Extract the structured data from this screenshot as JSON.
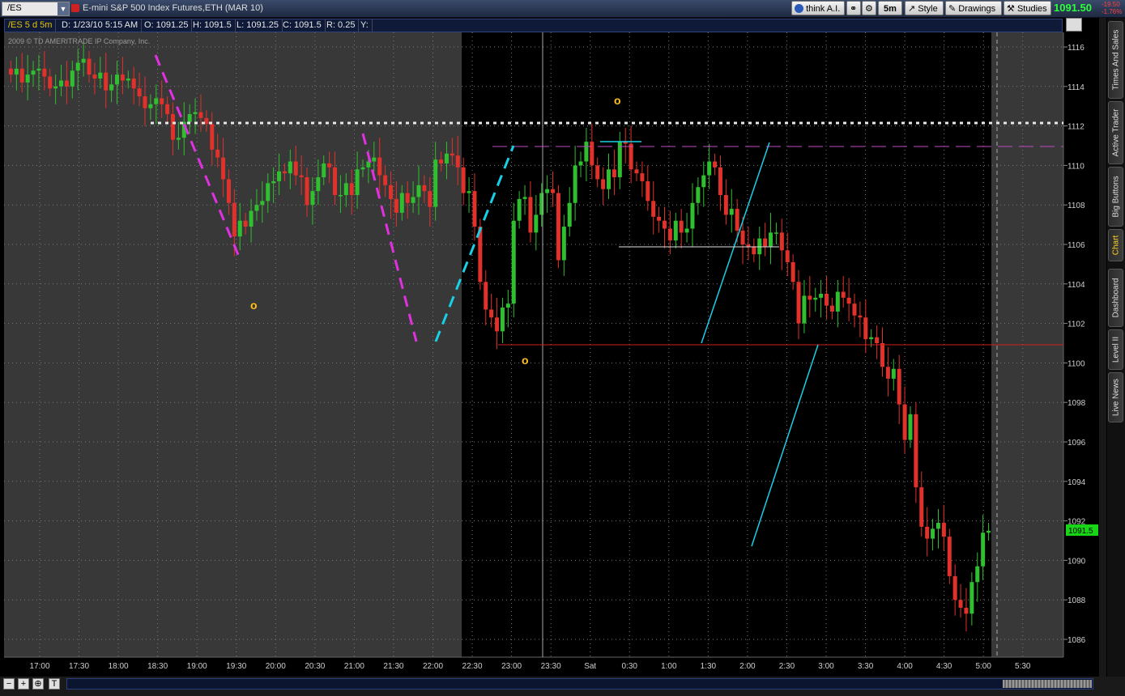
{
  "window": {
    "symbol": "/ES",
    "description": "E-mini S&P 500 Index Futures,ETH (MAR 10)",
    "last_price": "1091.50",
    "change": "-19.50",
    "change_pct": "-1.76%"
  },
  "toolbar": {
    "think_ai": "think A.I.",
    "period": "5m",
    "style": "Style",
    "drawings": "Drawings",
    "studies": "Studies"
  },
  "infobar": {
    "symbol_period": "/ES 5 d 5m",
    "date": "D: 1/23/10 5:15 AM",
    "open": "O: 1091.25",
    "high": "H: 1091.5",
    "low": "L: 1091.25",
    "close": "C: 1091.5",
    "range": "R: 0.25",
    "y": "Y:"
  },
  "copyright": "2009 © TD AMERITRADE IP Company, Inc.",
  "sidebar_tabs": [
    "Times And Sales",
    "Active Trader",
    "Big Buttons",
    "Chart",
    "Dashboard",
    "Level II",
    "Live News"
  ],
  "colors": {
    "up": "#2fbf2f",
    "down": "#e0312a",
    "magenta_line": "#e031e0",
    "cyan_line": "#19cfe6",
    "resistance": "#c24dc2",
    "support": "#d02020",
    "price_badge": "#16d616",
    "marker": "#ffc21a"
  },
  "chart_data": {
    "type": "candlestick",
    "title": "",
    "ylim": [
      1085.5,
      1117
    ],
    "y_ticks": [
      1086,
      1088,
      1090,
      1092,
      1094,
      1096,
      1098,
      1100,
      1102,
      1104,
      1106,
      1108,
      1110,
      1112,
      1114,
      1116
    ],
    "x_ticks": [
      "17:00",
      "17:30",
      "18:00",
      "18:30",
      "19:00",
      "19:30",
      "20:00",
      "20:30",
      "21:00",
      "21:30",
      "22:00",
      "22:30",
      "23:00",
      "23:30",
      "Sat",
      "0:30",
      "1:00",
      "1:30",
      "2:00",
      "2:30",
      "3:00",
      "3:30",
      "4:00",
      "4:30",
      "5:00",
      "5:30"
    ],
    "last_price_label": "1091.5",
    "grid": true,
    "closes": [
      1114.6,
      1114.9,
      1114.2,
      1114.6,
      1114.8,
      1114.9,
      1114.5,
      1113.9,
      1114.0,
      1114.3,
      1114.0,
      1114.8,
      1115.2,
      1115.4,
      1114.6,
      1114.4,
      1114.7,
      1113.8,
      1114.1,
      1114.6,
      1114.3,
      1114.4,
      1113.9,
      1113.5,
      1112.9,
      1113.1,
      1113.4,
      1113.1,
      1112.6,
      1111.3,
      1111.4,
      1112.2,
      1112.6,
      1112.7,
      1112.4,
      1112.1,
      1110.8,
      1110.4,
      1109.3,
      1108.1,
      1106.4,
      1107.2,
      1106.9,
      1107.7,
      1108.0,
      1108.2,
      1109.1,
      1109.2,
      1109.7,
      1109.6,
      1110.2,
      1109.5,
      1109.4,
      1108.0,
      1108.7,
      1109.4,
      1110.1,
      1109.9,
      1108.5,
      1108.5,
      1109.1,
      1108.5,
      1109.8,
      1109.9,
      1110.2,
      1110.4,
      1109.5,
      1109.0,
      1108.3,
      1107.6,
      1108.6,
      1108.1,
      1108.4,
      1109.0,
      1108.7,
      1107.9,
      1110.3,
      1110.1,
      1110.6,
      1110.5,
      1109.9,
      1108.6,
      1108.7,
      1106.9,
      1104.1,
      1102.7,
      1102.3,
      1101.6,
      1102.8,
      1103.0,
      1107.2,
      1108.3,
      1108.4,
      1106.6,
      1107.5,
      1108.6,
      1108.8,
      1108.6,
      1105.2,
      1106.9,
      1108.1,
      1110.0,
      1110.2,
      1111.2,
      1110.0,
      1109.3,
      1108.8,
      1109.8,
      1109.4,
      1111.2,
      1111.1,
      1109.8,
      1109.6,
      1109.2,
      1108.2,
      1107.4,
      1107.2,
      1106.8,
      1106.2,
      1107.2,
      1106.6,
      1106.8,
      1108.1,
      1108.9,
      1109.5,
      1110.2,
      1109.9,
      1108.5,
      1107.5,
      1107.8,
      1106.7,
      1106.0,
      1105.9,
      1105.5,
      1106.3,
      1105.9,
      1106.6,
      1106.6,
      1105.7,
      1105.1,
      1104.1,
      1102.0,
      1103.4,
      1103.2,
      1103.3,
      1103.5,
      1102.9,
      1102.6,
      1103.6,
      1103.3,
      1103.0,
      1102.4,
      1102.3,
      1101.2,
      1101.3,
      1101.0,
      1099.8,
      1099.2,
      1099.7,
      1097.9,
      1096.1,
      1097.4,
      1093.7,
      1091.7,
      1091.1,
      1091.6,
      1091.9,
      1091.2,
      1089.2,
      1088.0,
      1087.6,
      1087.3,
      1088.9,
      1089.7,
      1091.4,
      1091.5
    ],
    "annotations": [
      {
        "kind": "resistance",
        "price": 1112.2,
        "style": "dotted-white"
      },
      {
        "kind": "resistance",
        "price": 1111.0,
        "style": "dashed-magenta"
      },
      {
        "kind": "support",
        "price": 1101.0,
        "style": "solid-red"
      },
      {
        "kind": "marker",
        "label": "o"
      },
      {
        "kind": "marker",
        "label": "o"
      },
      {
        "kind": "marker",
        "label": "o"
      }
    ]
  }
}
